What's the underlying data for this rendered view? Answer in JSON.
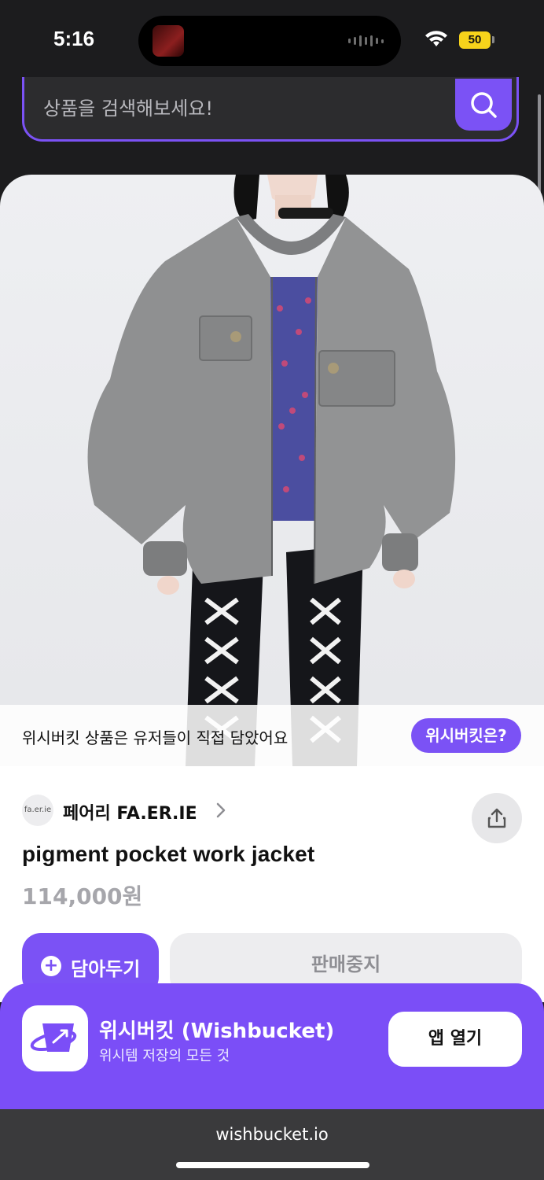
{
  "status_bar": {
    "time": "5:16",
    "battery": "50"
  },
  "search": {
    "placeholder": "상품을 검색해보세요!"
  },
  "notice": {
    "text": "위시버킷 상품은 유저들이 직접 담았어요",
    "button": "위시버킷은?"
  },
  "product": {
    "brand": "페어리 FA.ER.IE",
    "brand_logo_text": "fa.er.ie",
    "title": "pigment pocket work jacket",
    "price": "114,000원",
    "save_label": "담아두기",
    "save_plus": "+",
    "soldout_label": "판매중지"
  },
  "app_banner": {
    "name": "위시버킷 (Wishbucket)",
    "subtitle": "위시템 저장의 모든 것",
    "open_button": "앱 열기"
  },
  "browser": {
    "url": "wishbucket.io"
  },
  "colors": {
    "accent": "#7b52f5",
    "dark": "#1c1c1e",
    "price_gray": "#a6a6ab"
  }
}
